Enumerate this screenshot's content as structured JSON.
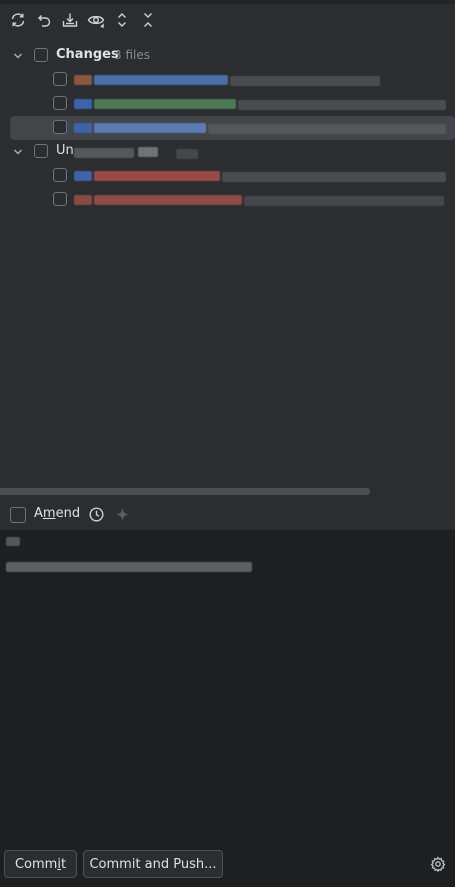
{
  "toolbar": {
    "icons": [
      "refresh-icon",
      "rollback-icon",
      "shelve-icon",
      "preview-icon",
      "expand-all-icon",
      "collapse-all-icon"
    ]
  },
  "changes_group": {
    "label": "Changes",
    "count": "3 files"
  },
  "unversioned_group": {
    "label": "Un"
  },
  "amend": {
    "label_pre": "A",
    "label_mnemonic": "m",
    "label_post": "end"
  },
  "actions": {
    "commit_pre": "Comm",
    "commit_mnemonic": "i",
    "commit_post": "t",
    "commit_push": "Commit and Push..."
  },
  "colors": {
    "panel_bg": "#2b2d30",
    "editor_bg": "#1e1f22",
    "selected_row": "#43454a",
    "text": "#dfe1e5",
    "muted": "#868a91"
  }
}
